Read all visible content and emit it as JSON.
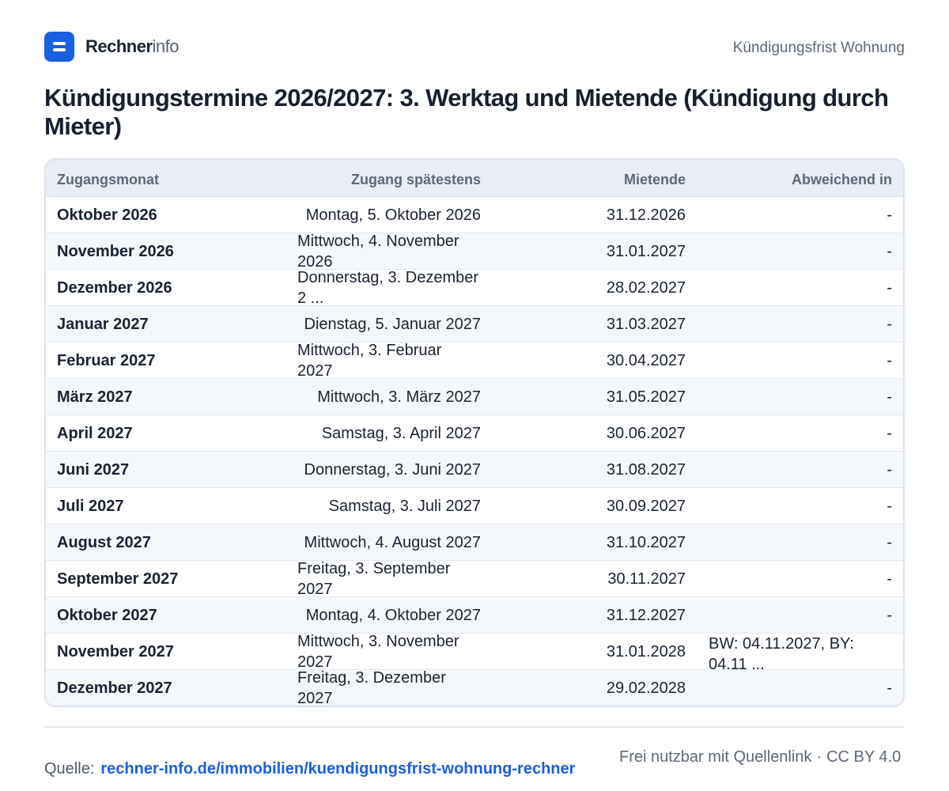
{
  "brand": {
    "name_strong": "Rechner",
    "name_light": "info",
    "accent_color": "#1a5fe0",
    "logo_icon": "equals-logo-icon"
  },
  "header": {
    "topic": "Kündigungsfrist Wohnung"
  },
  "page_title": "Kündigungstermine 2026/2027: 3. Werktag und Mietende (Kündigung durch Mieter)",
  "table": {
    "columns": [
      "Zugangsmonat",
      "Zugang spätestens",
      "Mietende",
      "Abweichend in"
    ],
    "rows": [
      {
        "month": "Oktober 2026",
        "deadline": "Montag, 5. Oktober 2026",
        "end": "31.12.2026",
        "exception": "-"
      },
      {
        "month": "November 2026",
        "deadline": "Mittwoch, 4. November 2026",
        "end": "31.01.2027",
        "exception": "-"
      },
      {
        "month": "Dezember 2026",
        "deadline": "Donnerstag, 3. Dezember 2 ...",
        "end": "28.02.2027",
        "exception": "-"
      },
      {
        "month": "Januar 2027",
        "deadline": "Dienstag, 5. Januar 2027",
        "end": "31.03.2027",
        "exception": "-"
      },
      {
        "month": "Februar 2027",
        "deadline": "Mittwoch, 3. Februar 2027",
        "end": "30.04.2027",
        "exception": "-"
      },
      {
        "month": "März 2027",
        "deadline": "Mittwoch, 3. März 2027",
        "end": "31.05.2027",
        "exception": "-"
      },
      {
        "month": "April 2027",
        "deadline": "Samstag, 3. April 2027",
        "end": "30.06.2027",
        "exception": "-"
      },
      {
        "month": "Juni 2027",
        "deadline": "Donnerstag, 3. Juni 2027",
        "end": "31.08.2027",
        "exception": "-"
      },
      {
        "month": "Juli 2027",
        "deadline": "Samstag, 3. Juli 2027",
        "end": "30.09.2027",
        "exception": "-"
      },
      {
        "month": "August 2027",
        "deadline": "Mittwoch, 4. August 2027",
        "end": "31.10.2027",
        "exception": "-"
      },
      {
        "month": "September 2027",
        "deadline": "Freitag, 3. September 2027",
        "end": "30.11.2027",
        "exception": "-"
      },
      {
        "month": "Oktober 2027",
        "deadline": "Montag, 4. Oktober 2027",
        "end": "31.12.2027",
        "exception": "-"
      },
      {
        "month": "November 2027",
        "deadline": "Mittwoch, 3. November 2027",
        "end": "31.01.2028",
        "exception": "BW: 04.11.2027, BY: 04.11 ..."
      },
      {
        "month": "Dezember 2027",
        "deadline": "Freitag, 3. Dezember 2027",
        "end": "29.02.2028",
        "exception": "-"
      }
    ]
  },
  "footer": {
    "source_label": "Quelle:",
    "source_link": "rechner-info.de/immobilien/kuendigungsfrist-wohnung-rechner",
    "license_text": "Frei nutzbar mit Quellenlink",
    "separator": "·",
    "license_name": "CC BY 4.0"
  }
}
